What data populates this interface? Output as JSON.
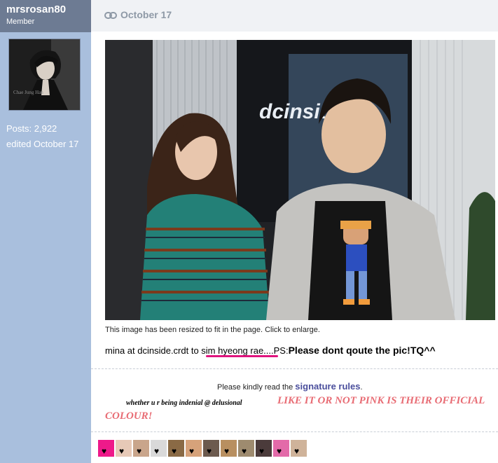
{
  "user": {
    "name": "mrsrosan80",
    "role": "Member",
    "avatar_caption": "Chae Jung Han",
    "posts_label": "Posts:",
    "posts_count": "2,922",
    "edited": "edited October 17"
  },
  "post": {
    "date": "October 17",
    "resize_note": "This image has been resized to fit in the page. Click to enlarge.",
    "photo_sign": "dcinside",
    "caption_start": "mina at dcinside.crdt to ",
    "caption_credit": "sim hyeong rae....",
    "caption_ps": "PS:",
    "caption_bold": "Please dont qoute the pic!TQ^^"
  },
  "signature": {
    "read_text": "Please kindly read the ",
    "rules_link": "signature rules",
    "rules_end": ".",
    "small_text": "whether u r being indenial @ delusional",
    "big_text_1": "LIKE IT OR NOT PINK IS THEIR OFFICIAL",
    "big_text_2": "COLOUR!"
  },
  "colors": {
    "sidebar": "#a9bfdd",
    "sidebar_header": "#6d7b93",
    "accent_pink": "#e0147e",
    "signature_red": "#e86c74",
    "link": "#4a4e9c"
  },
  "icons": {
    "permalink": "link-icon",
    "heart": "heart-icon"
  }
}
